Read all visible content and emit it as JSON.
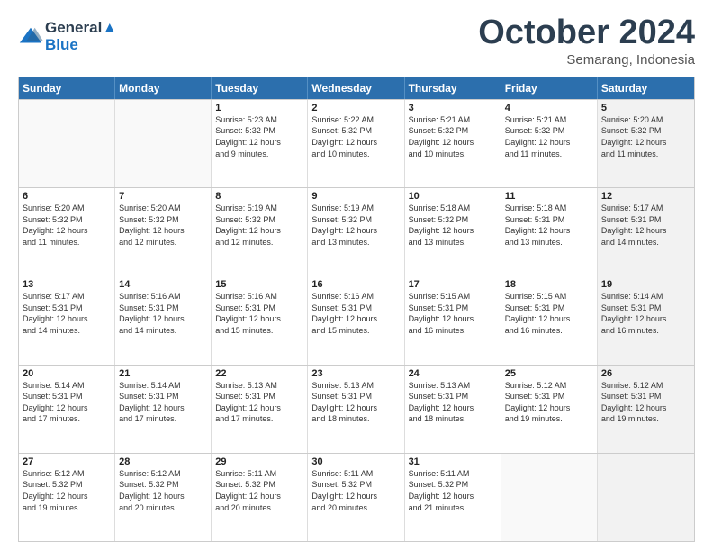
{
  "header": {
    "logo_line1": "General",
    "logo_line2": "Blue",
    "month_title": "October 2024",
    "location": "Semarang, Indonesia"
  },
  "days_of_week": [
    "Sunday",
    "Monday",
    "Tuesday",
    "Wednesday",
    "Thursday",
    "Friday",
    "Saturday"
  ],
  "weeks": [
    [
      {
        "day": "",
        "info": "",
        "empty": true
      },
      {
        "day": "",
        "info": "",
        "empty": true
      },
      {
        "day": "1",
        "info": "Sunrise: 5:23 AM\nSunset: 5:32 PM\nDaylight: 12 hours\nand 9 minutes."
      },
      {
        "day": "2",
        "info": "Sunrise: 5:22 AM\nSunset: 5:32 PM\nDaylight: 12 hours\nand 10 minutes."
      },
      {
        "day": "3",
        "info": "Sunrise: 5:21 AM\nSunset: 5:32 PM\nDaylight: 12 hours\nand 10 minutes."
      },
      {
        "day": "4",
        "info": "Sunrise: 5:21 AM\nSunset: 5:32 PM\nDaylight: 12 hours\nand 11 minutes."
      },
      {
        "day": "5",
        "info": "Sunrise: 5:20 AM\nSunset: 5:32 PM\nDaylight: 12 hours\nand 11 minutes.",
        "shaded": true
      }
    ],
    [
      {
        "day": "6",
        "info": "Sunrise: 5:20 AM\nSunset: 5:32 PM\nDaylight: 12 hours\nand 11 minutes."
      },
      {
        "day": "7",
        "info": "Sunrise: 5:20 AM\nSunset: 5:32 PM\nDaylight: 12 hours\nand 12 minutes."
      },
      {
        "day": "8",
        "info": "Sunrise: 5:19 AM\nSunset: 5:32 PM\nDaylight: 12 hours\nand 12 minutes."
      },
      {
        "day": "9",
        "info": "Sunrise: 5:19 AM\nSunset: 5:32 PM\nDaylight: 12 hours\nand 13 minutes."
      },
      {
        "day": "10",
        "info": "Sunrise: 5:18 AM\nSunset: 5:32 PM\nDaylight: 12 hours\nand 13 minutes."
      },
      {
        "day": "11",
        "info": "Sunrise: 5:18 AM\nSunset: 5:31 PM\nDaylight: 12 hours\nand 13 minutes."
      },
      {
        "day": "12",
        "info": "Sunrise: 5:17 AM\nSunset: 5:31 PM\nDaylight: 12 hours\nand 14 minutes.",
        "shaded": true
      }
    ],
    [
      {
        "day": "13",
        "info": "Sunrise: 5:17 AM\nSunset: 5:31 PM\nDaylight: 12 hours\nand 14 minutes."
      },
      {
        "day": "14",
        "info": "Sunrise: 5:16 AM\nSunset: 5:31 PM\nDaylight: 12 hours\nand 14 minutes."
      },
      {
        "day": "15",
        "info": "Sunrise: 5:16 AM\nSunset: 5:31 PM\nDaylight: 12 hours\nand 15 minutes."
      },
      {
        "day": "16",
        "info": "Sunrise: 5:16 AM\nSunset: 5:31 PM\nDaylight: 12 hours\nand 15 minutes."
      },
      {
        "day": "17",
        "info": "Sunrise: 5:15 AM\nSunset: 5:31 PM\nDaylight: 12 hours\nand 16 minutes."
      },
      {
        "day": "18",
        "info": "Sunrise: 5:15 AM\nSunset: 5:31 PM\nDaylight: 12 hours\nand 16 minutes."
      },
      {
        "day": "19",
        "info": "Sunrise: 5:14 AM\nSunset: 5:31 PM\nDaylight: 12 hours\nand 16 minutes.",
        "shaded": true
      }
    ],
    [
      {
        "day": "20",
        "info": "Sunrise: 5:14 AM\nSunset: 5:31 PM\nDaylight: 12 hours\nand 17 minutes."
      },
      {
        "day": "21",
        "info": "Sunrise: 5:14 AM\nSunset: 5:31 PM\nDaylight: 12 hours\nand 17 minutes."
      },
      {
        "day": "22",
        "info": "Sunrise: 5:13 AM\nSunset: 5:31 PM\nDaylight: 12 hours\nand 17 minutes."
      },
      {
        "day": "23",
        "info": "Sunrise: 5:13 AM\nSunset: 5:31 PM\nDaylight: 12 hours\nand 18 minutes."
      },
      {
        "day": "24",
        "info": "Sunrise: 5:13 AM\nSunset: 5:31 PM\nDaylight: 12 hours\nand 18 minutes."
      },
      {
        "day": "25",
        "info": "Sunrise: 5:12 AM\nSunset: 5:31 PM\nDaylight: 12 hours\nand 19 minutes."
      },
      {
        "day": "26",
        "info": "Sunrise: 5:12 AM\nSunset: 5:31 PM\nDaylight: 12 hours\nand 19 minutes.",
        "shaded": true
      }
    ],
    [
      {
        "day": "27",
        "info": "Sunrise: 5:12 AM\nSunset: 5:32 PM\nDaylight: 12 hours\nand 19 minutes."
      },
      {
        "day": "28",
        "info": "Sunrise: 5:12 AM\nSunset: 5:32 PM\nDaylight: 12 hours\nand 20 minutes."
      },
      {
        "day": "29",
        "info": "Sunrise: 5:11 AM\nSunset: 5:32 PM\nDaylight: 12 hours\nand 20 minutes."
      },
      {
        "day": "30",
        "info": "Sunrise: 5:11 AM\nSunset: 5:32 PM\nDaylight: 12 hours\nand 20 minutes."
      },
      {
        "day": "31",
        "info": "Sunrise: 5:11 AM\nSunset: 5:32 PM\nDaylight: 12 hours\nand 21 minutes."
      },
      {
        "day": "",
        "info": "",
        "empty": true
      },
      {
        "day": "",
        "info": "",
        "empty": true,
        "shaded": true
      }
    ]
  ]
}
